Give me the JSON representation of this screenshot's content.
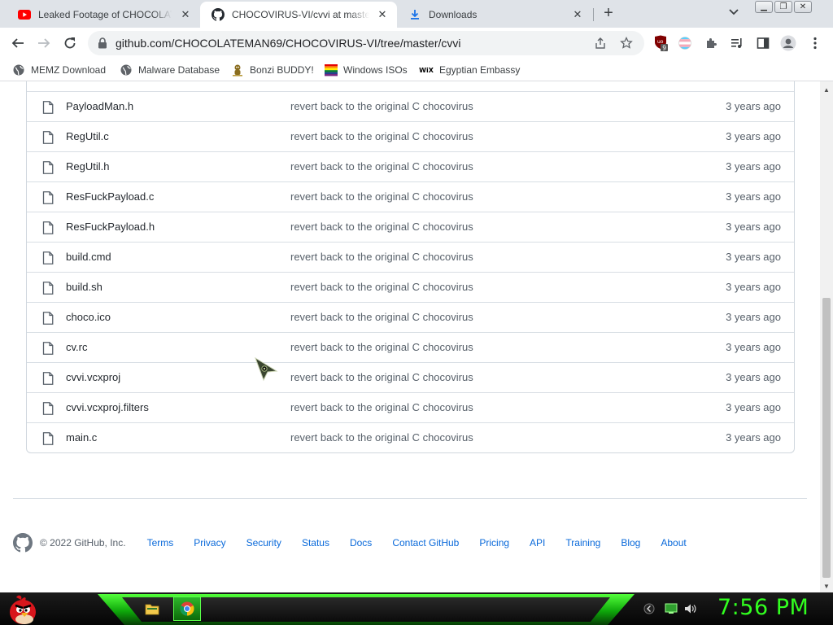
{
  "browser": {
    "tabs": [
      {
        "title": "Leaked Footage of CHOCOLATEMAN",
        "icon": "youtube-icon",
        "active": false
      },
      {
        "title": "CHOCOVIRUS-VI/cvvi at master",
        "icon": "github-icon",
        "active": true
      },
      {
        "title": "Downloads",
        "icon": "download-icon",
        "active": false
      }
    ],
    "url": "github.com/CHOCOLATEMAN69/CHOCOVIRUS-VI/tree/master/cvvi",
    "extension_badge": "9",
    "bookmarks": [
      {
        "label": "MEMZ Download",
        "icon": "globe-icon"
      },
      {
        "label": "Malware Database",
        "icon": "globe-icon"
      },
      {
        "label": "Bonzi BUDDY!",
        "icon": "bonzi-icon"
      },
      {
        "label": "Windows ISOs",
        "icon": "windows-icon"
      },
      {
        "label": "Egyptian Embassy",
        "icon": "wix-icon"
      }
    ],
    "wix_logo_text": "WiX"
  },
  "files": [
    {
      "name": "PayloadMan.h",
      "message": "revert back to the original C chocovirus",
      "age": "3 years ago"
    },
    {
      "name": "RegUtil.c",
      "message": "revert back to the original C chocovirus",
      "age": "3 years ago"
    },
    {
      "name": "RegUtil.h",
      "message": "revert back to the original C chocovirus",
      "age": "3 years ago"
    },
    {
      "name": "ResFuckPayload.c",
      "message": "revert back to the original C chocovirus",
      "age": "3 years ago"
    },
    {
      "name": "ResFuckPayload.h",
      "message": "revert back to the original C chocovirus",
      "age": "3 years ago"
    },
    {
      "name": "build.cmd",
      "message": "revert back to the original C chocovirus",
      "age": "3 years ago"
    },
    {
      "name": "build.sh",
      "message": "revert back to the original C chocovirus",
      "age": "3 years ago"
    },
    {
      "name": "choco.ico",
      "message": "revert back to the original C chocovirus",
      "age": "3 years ago"
    },
    {
      "name": "cv.rc",
      "message": "revert back to the original C chocovirus",
      "age": "3 years ago"
    },
    {
      "name": "cvvi.vcxproj",
      "message": "revert back to the original C chocovirus",
      "age": "3 years ago"
    },
    {
      "name": "cvvi.vcxproj.filters",
      "message": "revert back to the original C chocovirus",
      "age": "3 years ago"
    },
    {
      "name": "main.c",
      "message": "revert back to the original C chocovirus",
      "age": "3 years ago"
    }
  ],
  "footer": {
    "copyright": "© 2022 GitHub, Inc.",
    "links": [
      "Terms",
      "Privacy",
      "Security",
      "Status",
      "Docs",
      "Contact GitHub",
      "Pricing",
      "API",
      "Training",
      "Blog",
      "About"
    ]
  },
  "taskbar": {
    "clock": "7:56 PM"
  },
  "colors": {
    "link": "#0969da",
    "muted": "#57606a",
    "clock": "#31ff1f",
    "youtube": "#ff0000"
  }
}
